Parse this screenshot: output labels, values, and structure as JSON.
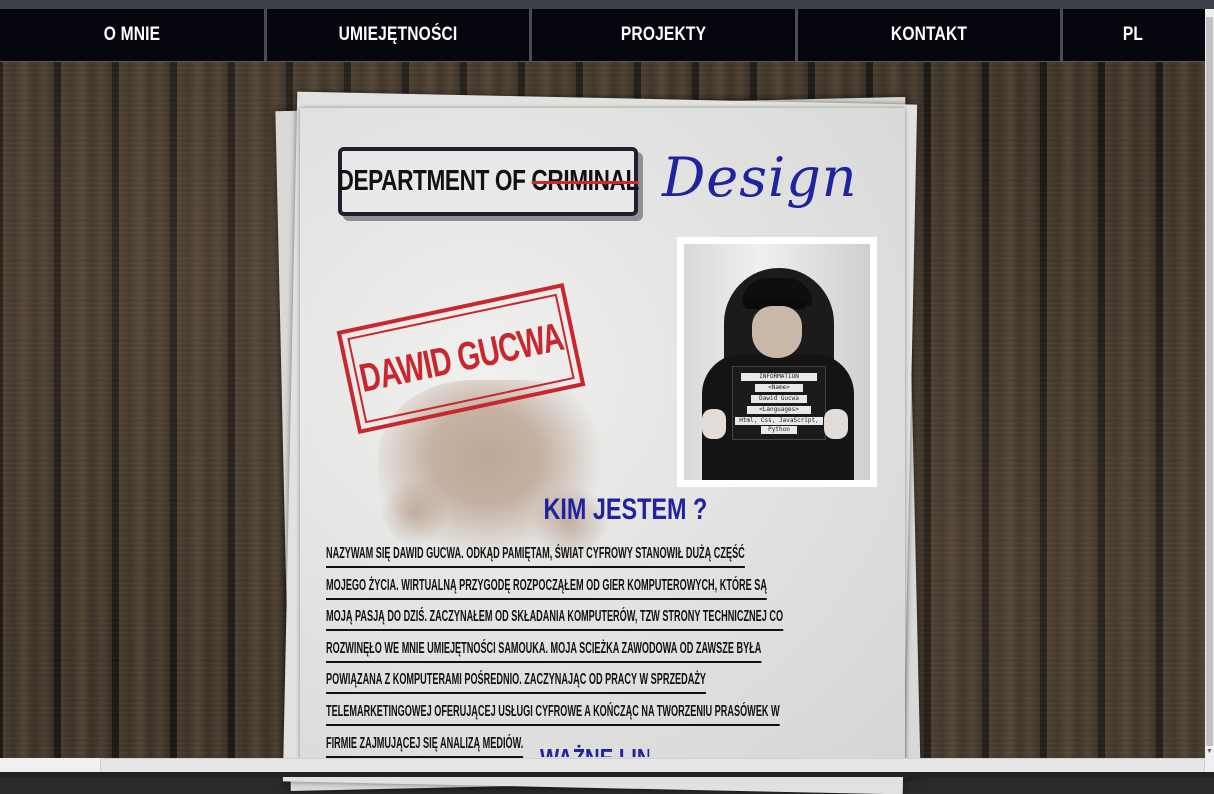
{
  "nav": {
    "items": [
      {
        "label": "O MNIE"
      },
      {
        "label": "UMIEJĘTNOŚCI"
      },
      {
        "label": "PROJEKTY"
      },
      {
        "label": "KONTAKT"
      },
      {
        "label": "PL"
      }
    ]
  },
  "logo": {
    "prefix": "DEPARTMENT OF ",
    "struck": "CRIMINAL",
    "script": "Design"
  },
  "stamp": {
    "name": "DAWID GUCWA"
  },
  "photo": {
    "sign_lines": [
      "INFORMATION",
      "<Name>",
      "Dawid Gucwa",
      "<Languages>",
      "Html, Css, JavaScript,",
      "Python"
    ]
  },
  "about": {
    "heading": "KIM JESTEM ?",
    "lines": [
      "NAZYWAM SIĘ DAWID GUCWA. ODKĄD PAMIĘTAM, ŚWIAT CYFROWY STANOWIŁ DUŻĄ CZĘŚĆ",
      "MOJEGO ŻYCIA. WIRTUALNĄ PRZYGODĘ ROZPOCZĄŁEM OD GIER KOMPUTEROWYCH, KTÓRE SĄ",
      "MOJĄ PASJĄ DO DZIŚ. ZACZYNAŁEM OD SKŁADANIA KOMPUTERÓW, TZW STRONY TECHNICZNEJ CO",
      "ROZWINĘŁO WE MNIE UMIEJĘTNOŚCI SAMOUKA. MOJA SCIEŻKA ZAWODOWA OD ZAWSZE BYŁA",
      "POWIĄZANA Z KOMPUTERAMI POŚREDNIO. ZACZYNAJĄC OD PRACY W SPRZEDAŻY",
      "TELEMARKETINGOWEJ OFERUJĄCEJ USŁUGI CYFROWE A KOŃCZĄC NA TWORZENIU PRASÓWEK W",
      "FIRMIE ZAJMUJĄCEJ SIĘ ANALIZĄ MEDIÓW."
    ]
  },
  "links": {
    "heading": "WAŻNE LINKI"
  },
  "colors": {
    "accent_blue": "#1f23a0",
    "stamp_red": "#c8282d",
    "nav_bg": "#06060e"
  }
}
